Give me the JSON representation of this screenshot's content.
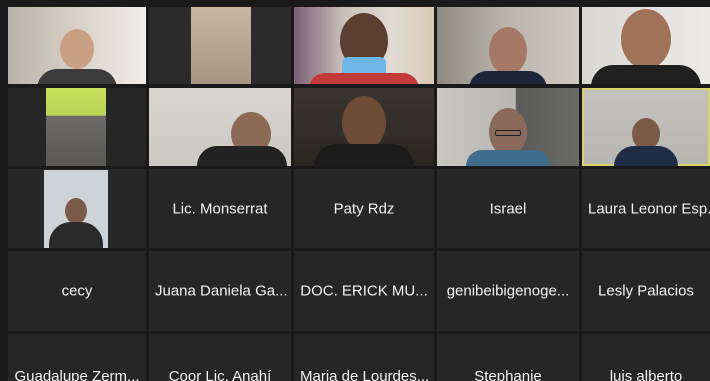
{
  "participants": [
    {
      "name": "",
      "kind": "video"
    },
    {
      "name": "",
      "kind": "video"
    },
    {
      "name": "",
      "kind": "video"
    },
    {
      "name": "",
      "kind": "video"
    },
    {
      "name": "",
      "kind": "video"
    },
    {
      "name": "",
      "kind": "video"
    },
    {
      "name": "",
      "kind": "video"
    },
    {
      "name": "",
      "kind": "video"
    },
    {
      "name": "",
      "kind": "video"
    },
    {
      "name": "",
      "kind": "video"
    },
    {
      "name": "",
      "kind": "avatar"
    },
    {
      "name": "Lic. Monserrat",
      "kind": "name"
    },
    {
      "name": "Paty Rdz",
      "kind": "name"
    },
    {
      "name": "Israel",
      "kind": "name"
    },
    {
      "name": "Laura Leonor Esp...",
      "kind": "name"
    },
    {
      "name": "cecy",
      "kind": "name"
    },
    {
      "name": "Juana Daniela Ga...",
      "kind": "name"
    },
    {
      "name": "DOC. ERICK MU...",
      "kind": "name"
    },
    {
      "name": "genibeibigenoge...",
      "kind": "name"
    },
    {
      "name": "Lesly Palacios",
      "kind": "name"
    },
    {
      "name": "Guadalupe Zerm...",
      "kind": "name"
    },
    {
      "name": "Coor Lic. Anahí",
      "kind": "name"
    },
    {
      "name": "Maria de Lourdes...",
      "kind": "name"
    },
    {
      "name": "Stephanie",
      "kind": "name"
    },
    {
      "name": "luis alberto",
      "kind": "name"
    }
  ]
}
